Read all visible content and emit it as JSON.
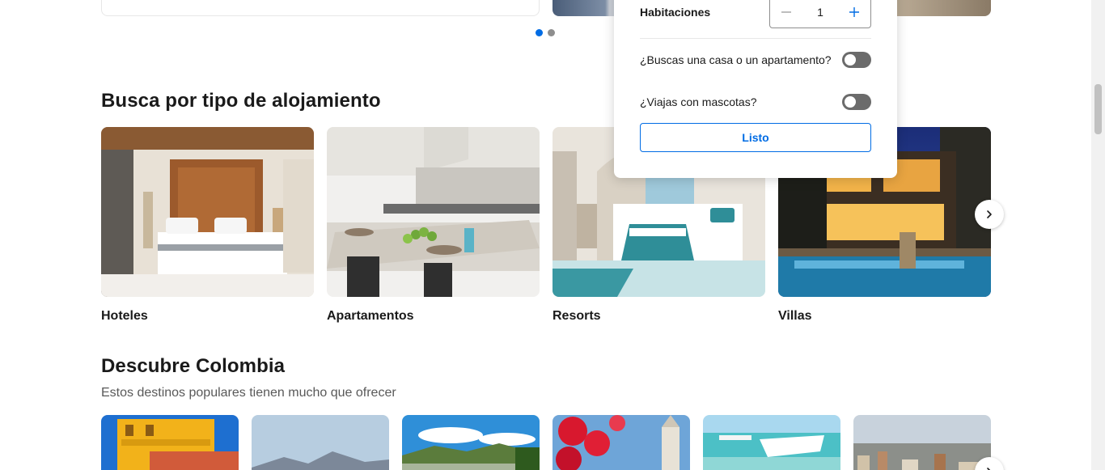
{
  "popup": {
    "rooms_label": "Habitaciones",
    "rooms_value": "1",
    "house_question": "¿Buscas una casa o un apartamento?",
    "pets_question": "¿Viajas con mascotas?",
    "done_label": "Listo"
  },
  "property_types": {
    "title": "Busca por tipo de alojamiento",
    "items": [
      {
        "label": "Hoteles"
      },
      {
        "label": "Apartamentos"
      },
      {
        "label": "Resorts"
      },
      {
        "label": "Villas"
      }
    ]
  },
  "discover": {
    "title": "Descubre Colombia",
    "subtitle": "Estos destinos populares tienen mucho que ofrecer"
  },
  "colors": {
    "accent": "#006ce4",
    "toggle_off": "#6b6b6b"
  },
  "icons": {
    "next": "chevron-right-icon",
    "minus": "minus-icon",
    "plus": "plus-icon"
  }
}
